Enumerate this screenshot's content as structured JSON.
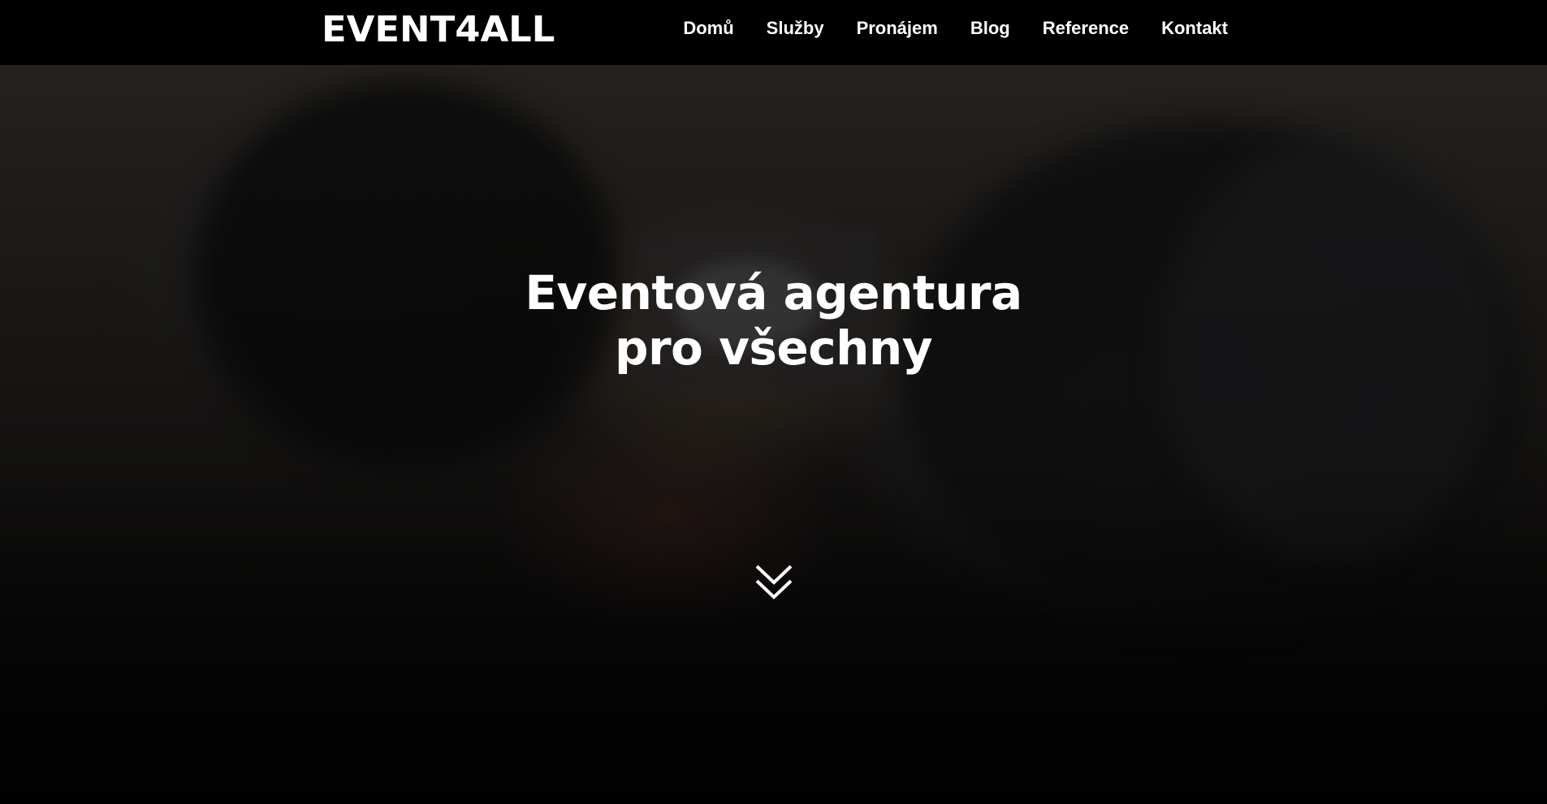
{
  "header": {
    "logo": "EVENT4ALL",
    "nav": [
      {
        "label": "Domů"
      },
      {
        "label": "Služby"
      },
      {
        "label": "Pronájem"
      },
      {
        "label": "Blog"
      },
      {
        "label": "Reference"
      },
      {
        "label": "Kontakt"
      }
    ]
  },
  "hero": {
    "title_line1": "Eventová agentura",
    "title_line2": "pro všechny",
    "scroll_icon": "double-chevron-down-icon"
  },
  "colors": {
    "header_bg": "#000000",
    "text": "#ffffff"
  }
}
